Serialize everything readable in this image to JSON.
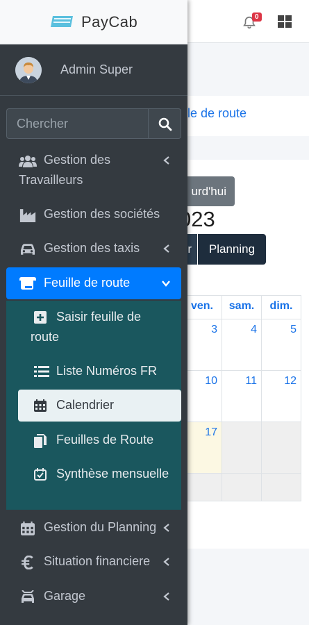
{
  "app": {
    "name": "PayCab"
  },
  "header": {
    "notification_count": "0"
  },
  "user": {
    "name": "Admin Super"
  },
  "search": {
    "placeholder": "Chercher"
  },
  "sidebar": {
    "items": [
      {
        "label": "Gestion des Travailleurs",
        "icon": "users-icon",
        "has_chevron": true
      },
      {
        "label": "Gestion des sociétés",
        "icon": "industry-icon",
        "has_chevron": false
      },
      {
        "label": "Gestion des taxis",
        "icon": "car-icon",
        "has_chevron": true
      },
      {
        "label": "Feuille de route",
        "icon": "scroll-icon",
        "has_chevron": true,
        "active": true
      },
      {
        "label": "Gestion du Planning",
        "icon": "calendar-icon",
        "has_chevron": true
      },
      {
        "label": "Situation financiere",
        "icon": "euro-icon",
        "has_chevron": true
      },
      {
        "label": "Garage",
        "icon": "car-repair-icon",
        "has_chevron": true
      }
    ],
    "submenu": [
      {
        "label": "Saisir feuille de route",
        "icon": "plus-square-icon"
      },
      {
        "label": "Liste Numéros FR",
        "icon": "list-icon"
      },
      {
        "label": "Calendrier",
        "icon": "calendar-icon",
        "active": true
      },
      {
        "label": "Feuilles de Route",
        "icon": "copy-icon"
      },
      {
        "label": "Synthèse mensuelle",
        "icon": "calendar-check-icon"
      }
    ]
  },
  "main": {
    "card_link": "ille de route",
    "today_button": "urd'hui",
    "year_fragment": "023",
    "view_buttons": [
      "r",
      "Planning"
    ],
    "weekdays": [
      "ven.",
      "sam.",
      "dim."
    ],
    "weeks": [
      [
        "3",
        "4",
        "5"
      ],
      [
        "10",
        "11",
        "12"
      ],
      [
        "17",
        "",
        ""
      ]
    ]
  },
  "colors": {
    "sidebar_bg": "#343a40",
    "active": "#007bff",
    "submenu_bg": "#1a575e",
    "notification": "#dc3545"
  }
}
